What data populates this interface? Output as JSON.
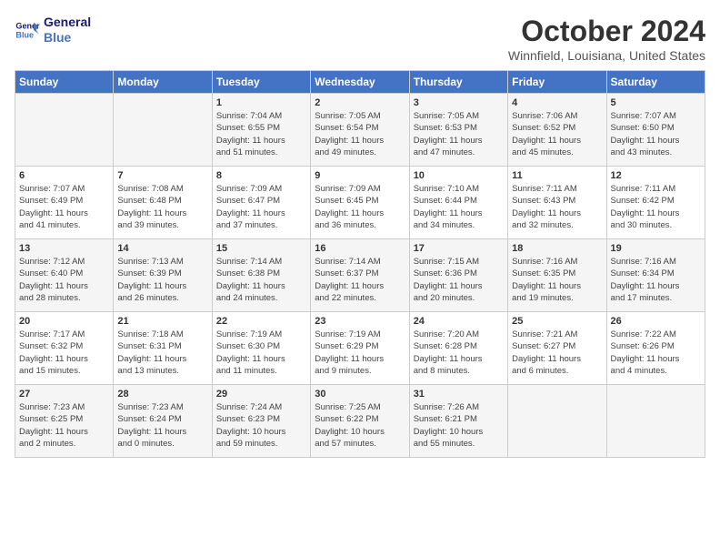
{
  "logo": {
    "line1": "General",
    "line2": "Blue"
  },
  "title": "October 2024",
  "subtitle": "Winnfield, Louisiana, United States",
  "days_of_week": [
    "Sunday",
    "Monday",
    "Tuesday",
    "Wednesday",
    "Thursday",
    "Friday",
    "Saturday"
  ],
  "weeks": [
    [
      {
        "day": "",
        "details": ""
      },
      {
        "day": "",
        "details": ""
      },
      {
        "day": "1",
        "details": "Sunrise: 7:04 AM\nSunset: 6:55 PM\nDaylight: 11 hours\nand 51 minutes."
      },
      {
        "day": "2",
        "details": "Sunrise: 7:05 AM\nSunset: 6:54 PM\nDaylight: 11 hours\nand 49 minutes."
      },
      {
        "day": "3",
        "details": "Sunrise: 7:05 AM\nSunset: 6:53 PM\nDaylight: 11 hours\nand 47 minutes."
      },
      {
        "day": "4",
        "details": "Sunrise: 7:06 AM\nSunset: 6:52 PM\nDaylight: 11 hours\nand 45 minutes."
      },
      {
        "day": "5",
        "details": "Sunrise: 7:07 AM\nSunset: 6:50 PM\nDaylight: 11 hours\nand 43 minutes."
      }
    ],
    [
      {
        "day": "6",
        "details": "Sunrise: 7:07 AM\nSunset: 6:49 PM\nDaylight: 11 hours\nand 41 minutes."
      },
      {
        "day": "7",
        "details": "Sunrise: 7:08 AM\nSunset: 6:48 PM\nDaylight: 11 hours\nand 39 minutes."
      },
      {
        "day": "8",
        "details": "Sunrise: 7:09 AM\nSunset: 6:47 PM\nDaylight: 11 hours\nand 37 minutes."
      },
      {
        "day": "9",
        "details": "Sunrise: 7:09 AM\nSunset: 6:45 PM\nDaylight: 11 hours\nand 36 minutes."
      },
      {
        "day": "10",
        "details": "Sunrise: 7:10 AM\nSunset: 6:44 PM\nDaylight: 11 hours\nand 34 minutes."
      },
      {
        "day": "11",
        "details": "Sunrise: 7:11 AM\nSunset: 6:43 PM\nDaylight: 11 hours\nand 32 minutes."
      },
      {
        "day": "12",
        "details": "Sunrise: 7:11 AM\nSunset: 6:42 PM\nDaylight: 11 hours\nand 30 minutes."
      }
    ],
    [
      {
        "day": "13",
        "details": "Sunrise: 7:12 AM\nSunset: 6:40 PM\nDaylight: 11 hours\nand 28 minutes."
      },
      {
        "day": "14",
        "details": "Sunrise: 7:13 AM\nSunset: 6:39 PM\nDaylight: 11 hours\nand 26 minutes."
      },
      {
        "day": "15",
        "details": "Sunrise: 7:14 AM\nSunset: 6:38 PM\nDaylight: 11 hours\nand 24 minutes."
      },
      {
        "day": "16",
        "details": "Sunrise: 7:14 AM\nSunset: 6:37 PM\nDaylight: 11 hours\nand 22 minutes."
      },
      {
        "day": "17",
        "details": "Sunrise: 7:15 AM\nSunset: 6:36 PM\nDaylight: 11 hours\nand 20 minutes."
      },
      {
        "day": "18",
        "details": "Sunrise: 7:16 AM\nSunset: 6:35 PM\nDaylight: 11 hours\nand 19 minutes."
      },
      {
        "day": "19",
        "details": "Sunrise: 7:16 AM\nSunset: 6:34 PM\nDaylight: 11 hours\nand 17 minutes."
      }
    ],
    [
      {
        "day": "20",
        "details": "Sunrise: 7:17 AM\nSunset: 6:32 PM\nDaylight: 11 hours\nand 15 minutes."
      },
      {
        "day": "21",
        "details": "Sunrise: 7:18 AM\nSunset: 6:31 PM\nDaylight: 11 hours\nand 13 minutes."
      },
      {
        "day": "22",
        "details": "Sunrise: 7:19 AM\nSunset: 6:30 PM\nDaylight: 11 hours\nand 11 minutes."
      },
      {
        "day": "23",
        "details": "Sunrise: 7:19 AM\nSunset: 6:29 PM\nDaylight: 11 hours\nand 9 minutes."
      },
      {
        "day": "24",
        "details": "Sunrise: 7:20 AM\nSunset: 6:28 PM\nDaylight: 11 hours\nand 8 minutes."
      },
      {
        "day": "25",
        "details": "Sunrise: 7:21 AM\nSunset: 6:27 PM\nDaylight: 11 hours\nand 6 minutes."
      },
      {
        "day": "26",
        "details": "Sunrise: 7:22 AM\nSunset: 6:26 PM\nDaylight: 11 hours\nand 4 minutes."
      }
    ],
    [
      {
        "day": "27",
        "details": "Sunrise: 7:23 AM\nSunset: 6:25 PM\nDaylight: 11 hours\nand 2 minutes."
      },
      {
        "day": "28",
        "details": "Sunrise: 7:23 AM\nSunset: 6:24 PM\nDaylight: 11 hours\nand 0 minutes."
      },
      {
        "day": "29",
        "details": "Sunrise: 7:24 AM\nSunset: 6:23 PM\nDaylight: 10 hours\nand 59 minutes."
      },
      {
        "day": "30",
        "details": "Sunrise: 7:25 AM\nSunset: 6:22 PM\nDaylight: 10 hours\nand 57 minutes."
      },
      {
        "day": "31",
        "details": "Sunrise: 7:26 AM\nSunset: 6:21 PM\nDaylight: 10 hours\nand 55 minutes."
      },
      {
        "day": "",
        "details": ""
      },
      {
        "day": "",
        "details": ""
      }
    ]
  ]
}
